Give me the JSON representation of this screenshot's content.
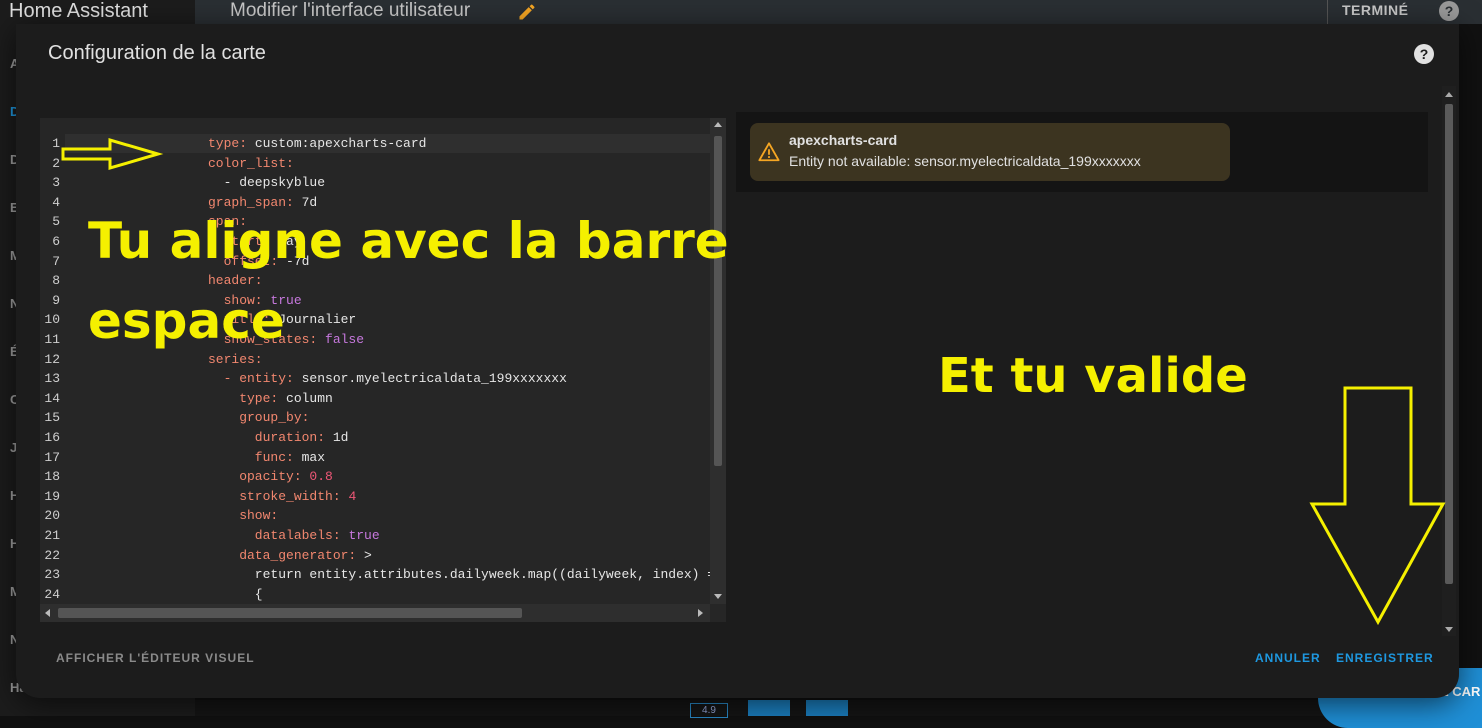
{
  "app": {
    "title": "Home Assistant",
    "sidebar_letters": [
      "A",
      "D",
      "D",
      "E",
      "M",
      "N",
      "É",
      "C",
      "J",
      "H",
      "H",
      "M",
      "N",
      "Ha"
    ]
  },
  "topbar": {
    "title": "Modifier l'interface utilisateur",
    "done_label": "TERMINÉ",
    "help_glyph": "?"
  },
  "background": {
    "badge": "4.9",
    "fab_label": "E CAR"
  },
  "dialog": {
    "title": "Configuration de la carte",
    "help_glyph": "?",
    "visual_editor_label": "AFFICHER L'ÉDITEUR VISUEL",
    "cancel_label": "ANNULER",
    "save_label": "ENREGISTRER"
  },
  "editor": {
    "lines": [
      {
        "n": "1",
        "k": "type: ",
        "v": "custom:apexcharts-card",
        "c": "v"
      },
      {
        "n": "2",
        "k": "color_list:",
        "v": "",
        "c": "v"
      },
      {
        "n": "3",
        "k": "",
        "v": "  - deepskyblue",
        "c": "v"
      },
      {
        "n": "4",
        "k": "graph_span: ",
        "v": "7d",
        "c": "v"
      },
      {
        "n": "5",
        "k": "span:",
        "v": "",
        "c": "v"
      },
      {
        "n": "6",
        "k": "  start: ",
        "v": "day",
        "c": "v"
      },
      {
        "n": "7",
        "k": "  offset: ",
        "v": "-7d",
        "c": "v"
      },
      {
        "n": "8",
        "k": "header:",
        "v": "",
        "c": "v"
      },
      {
        "n": "9",
        "k": "  show: ",
        "v": "true",
        "c": "b"
      },
      {
        "n": "10",
        "k": "  title: ",
        "v": "Journalier",
        "c": "v"
      },
      {
        "n": "11",
        "k": "  show_states: ",
        "v": "false",
        "c": "b"
      },
      {
        "n": "12",
        "k": "series:",
        "v": "",
        "c": "v"
      },
      {
        "n": "13",
        "k": "  - entity: ",
        "v": "sensor.myelectricaldata_199xxxxxxx",
        "c": "v"
      },
      {
        "n": "14",
        "k": "    type: ",
        "v": "column",
        "c": "v"
      },
      {
        "n": "15",
        "k": "    group_by:",
        "v": "",
        "c": "v"
      },
      {
        "n": "16",
        "k": "      duration: ",
        "v": "1d",
        "c": "v"
      },
      {
        "n": "17",
        "k": "      func: ",
        "v": "max",
        "c": "v"
      },
      {
        "n": "18",
        "k": "    opacity: ",
        "v": "0.8",
        "c": "n"
      },
      {
        "n": "19",
        "k": "    stroke_width: ",
        "v": "4",
        "c": "n"
      },
      {
        "n": "20",
        "k": "    show:",
        "v": "",
        "c": "v"
      },
      {
        "n": "21",
        "k": "      datalabels: ",
        "v": "true",
        "c": "b"
      },
      {
        "n": "22",
        "k": "    data_generator: ",
        "v": ">",
        "c": "v"
      },
      {
        "n": "23",
        "k": "",
        "v": "      return entity.attributes.dailyweek.map((dailyweek, index) =>",
        "c": "v"
      },
      {
        "n": "24",
        "k": "",
        "v": "      {",
        "c": "v"
      }
    ]
  },
  "preview": {
    "alert_title": "apexcharts-card",
    "alert_message": "Entity not available: sensor.myelectricaldata_199xxxxxxx",
    "icon": "warning-icon",
    "warning_color": "#f5a623"
  },
  "overlays": {
    "line1": "Tu  aligne avec la barre",
    "line2": "espace",
    "line3": "Et  tu valide",
    "color": "#f5f000"
  }
}
